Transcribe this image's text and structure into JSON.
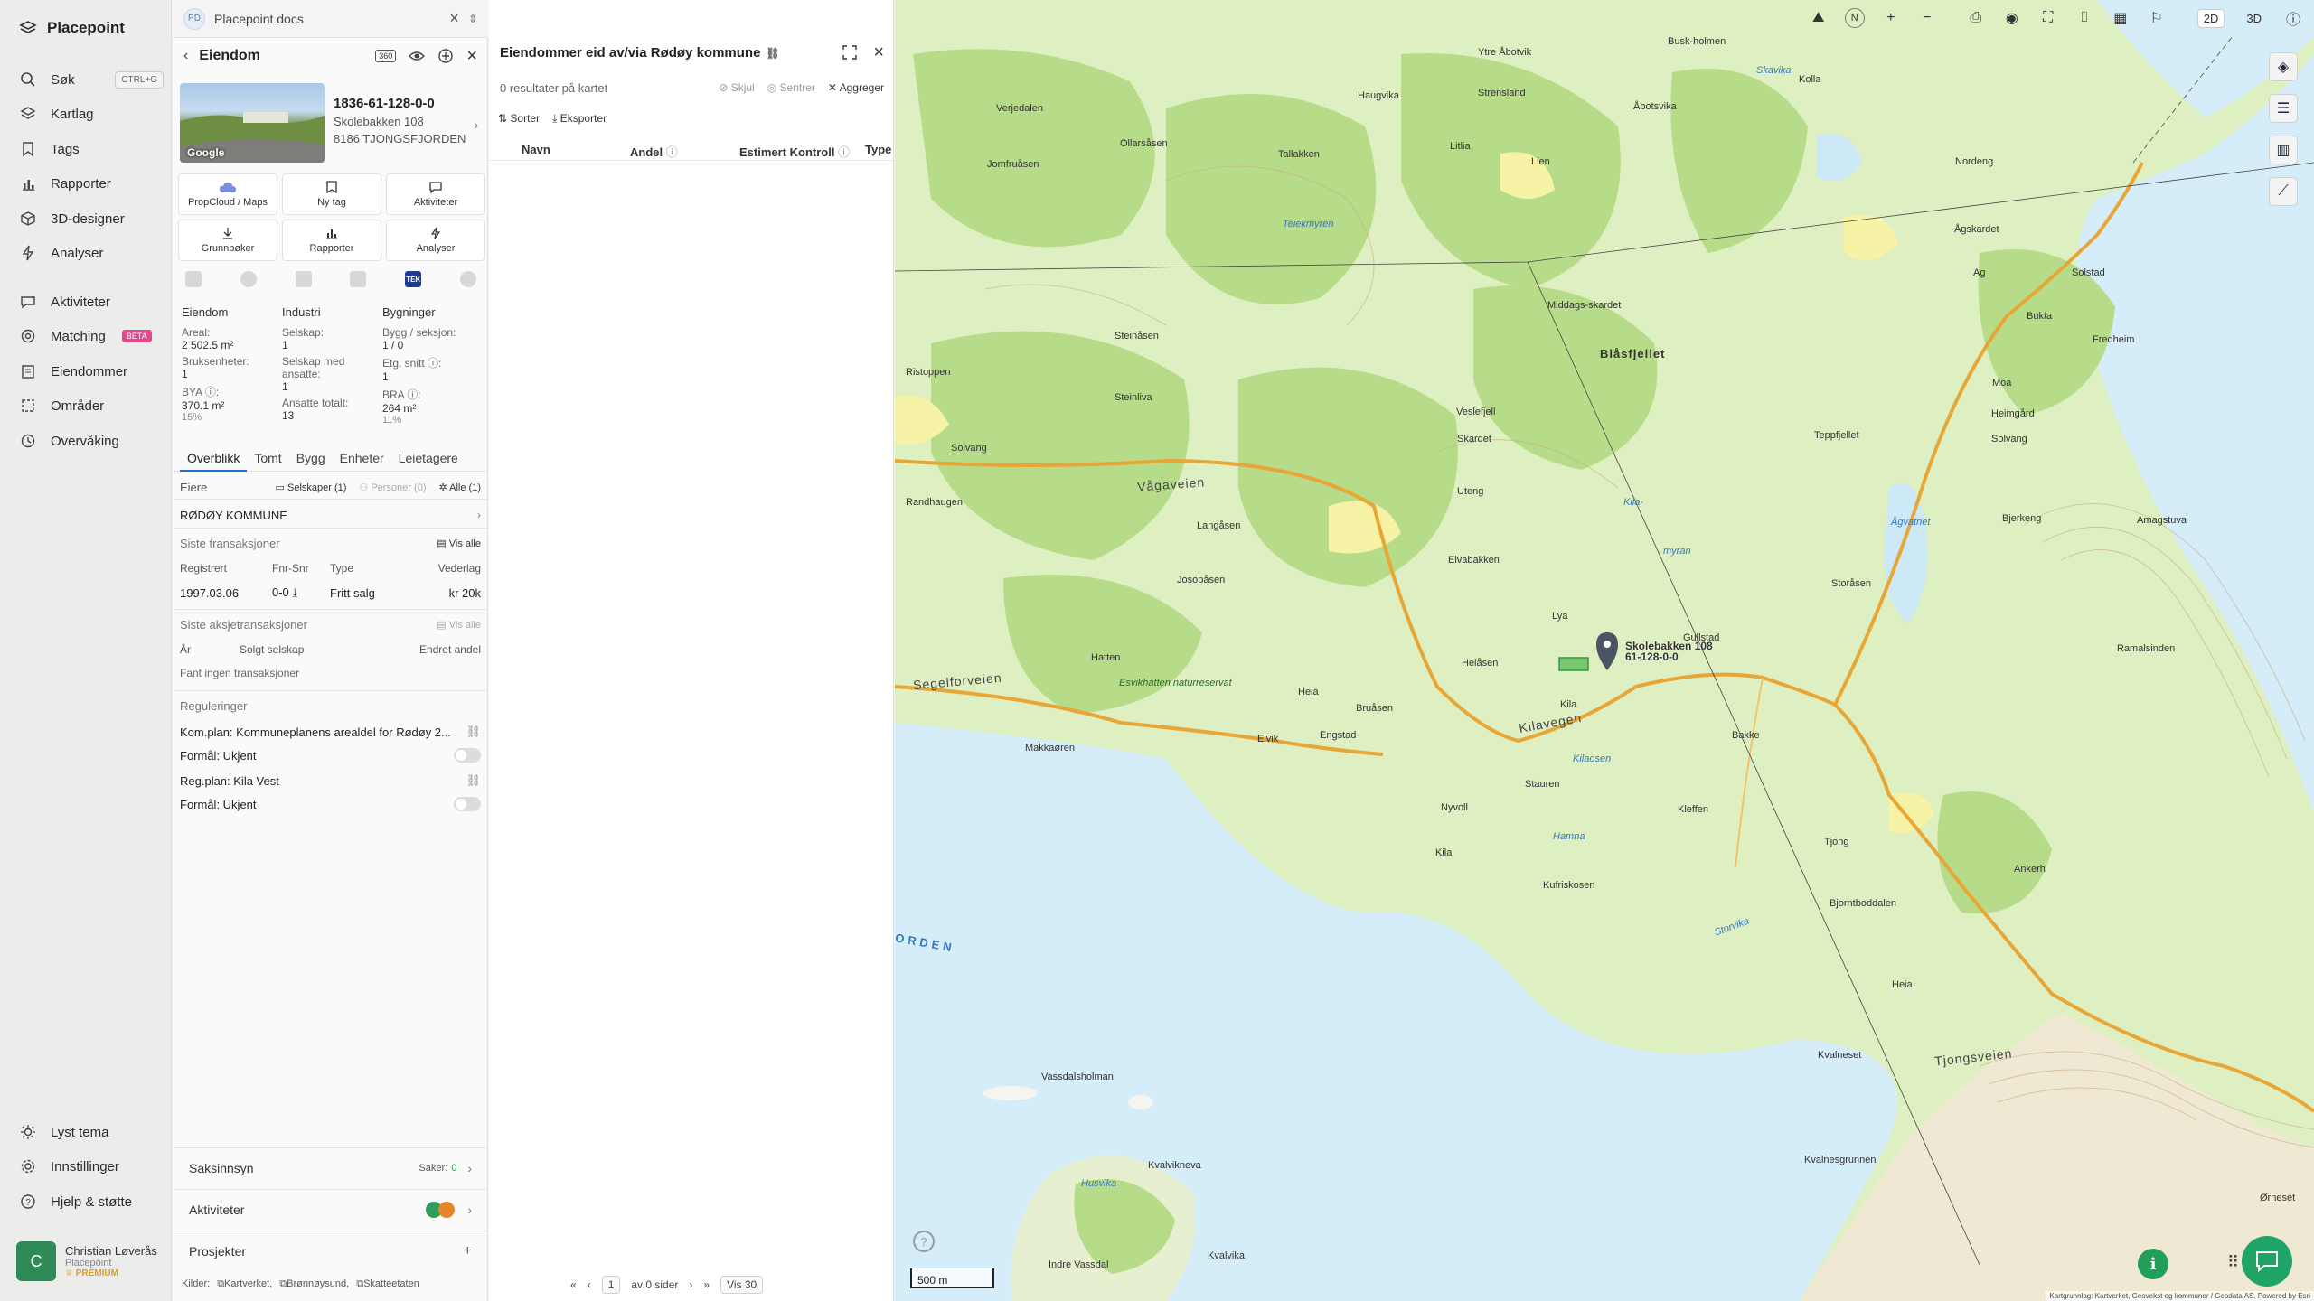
{
  "sidebar": {
    "brand": "Placepoint",
    "search_shortcut": "CTRL+G",
    "items": [
      {
        "label": "Søk"
      },
      {
        "label": "Kartlag"
      },
      {
        "label": "Tags"
      },
      {
        "label": "Rapporter"
      },
      {
        "label": "3D-designer"
      },
      {
        "label": "Analyser"
      },
      {
        "label": "Aktiviteter"
      },
      {
        "label": "Matching",
        "badge": "BETA"
      },
      {
        "label": "Eiendommer"
      },
      {
        "label": "Områder"
      },
      {
        "label": "Overvåking"
      }
    ],
    "bottom": [
      {
        "label": "Lyst tema"
      },
      {
        "label": "Innstillinger"
      },
      {
        "label": "Hjelp & støtte"
      }
    ],
    "user": {
      "initial": "C",
      "name": "Christian Løverås",
      "org": "Placepoint",
      "plan": "PREMIUM"
    }
  },
  "docs": {
    "logo": "PD",
    "title": "Placepoint docs"
  },
  "property": {
    "header": "Eiendom",
    "badge360": "360",
    "photo_credit": "Google",
    "id": "1836-61-128-0-0",
    "address1": "Skolebakken 108",
    "address2": "8186 TJONGSFJORDEN",
    "actions": [
      {
        "label": "PropCloud / Maps"
      },
      {
        "label": "Ny tag"
      },
      {
        "label": "Aktiviteter"
      },
      {
        "label": "Grunnbøker"
      },
      {
        "label": "Rapporter"
      },
      {
        "label": "Analyser"
      }
    ],
    "tek_label": "TEK",
    "stats": {
      "col1": {
        "heading": "Eiendom",
        "areal_label": "Areal:",
        "areal": "2 502.5 m²",
        "bruks_label": "Bruksenheter:",
        "bruks": "1",
        "bya_label": "BYA ⓘ:",
        "bya": "370.1 m²",
        "bya_pct": "15%"
      },
      "col2": {
        "heading": "Industri",
        "selskap_label": "Selskap:",
        "selskap": "1",
        "ansatte_label": "Selskap med ansatte:",
        "ansatte": "1",
        "totalt_label": "Ansatte totalt:",
        "totalt": "13"
      },
      "col3": {
        "heading": "Bygninger",
        "bygg_label": "Bygg / seksjon:",
        "bygg": "1 / 0",
        "etg_label": "Etg. snitt ⓘ:",
        "etg": "1",
        "bra_label": "BRA ⓘ:",
        "bra": "264 m²",
        "bra_pct": "11%"
      }
    },
    "tabs": [
      {
        "label": "Overblikk"
      },
      {
        "label": "Tomt"
      },
      {
        "label": "Bygg"
      },
      {
        "label": "Enheter"
      },
      {
        "label": "Leietagere"
      }
    ],
    "owners": {
      "label": "Eiere",
      "f1": "Selskaper (1)",
      "f2": "Personer (0)",
      "f3": "Alle (1)",
      "owner": "RØDØY KOMMUNE"
    },
    "transactions": {
      "title": "Siste transaksjoner",
      "view_all": "Vis alle",
      "cols": [
        "Registrert",
        "Fnr-Snr",
        "Type",
        "Vederlag"
      ],
      "row": {
        "date": "1997.03.06",
        "fnr": "0-0",
        "type": "Fritt salg",
        "amount": "kr 20k"
      }
    },
    "share_tx": {
      "title": "Siste aksjetransaksjoner",
      "view_all": "Vis alle",
      "cols": [
        "År",
        "Solgt selskap",
        "Endret andel"
      ],
      "empty": "Fant ingen transaksjoner"
    },
    "regulations": {
      "title": "Reguleringer",
      "items": [
        "Kom.plan: Kommuneplanens arealdel for Rødøy 2...",
        "Formål: Ukjent",
        "Reg.plan: Kila Vest",
        "Formål: Ukjent"
      ]
    },
    "saksinnsyn": {
      "label": "Saksinnsyn",
      "count_label": "Saker:",
      "count": "0"
    },
    "aktiviteter": {
      "label": "Aktiviteter"
    },
    "prosjekter": {
      "label": "Prosjekter",
      "add": "+"
    },
    "sources": {
      "label": "Kilder:",
      "items": [
        "Kartverket",
        "Brønnøysund",
        "Skatteetaten"
      ]
    }
  },
  "owned": {
    "title": "Eiendommer eid av/via Rødøy kommune",
    "sub": "0 resultater på kartet",
    "skjul": "Skjul",
    "sentrer": "Sentrer",
    "aggreger": "Aggreger",
    "sort": "Sorter",
    "export": "Eksporter",
    "cols": [
      "Navn",
      "Andel",
      "Estimert Kontroll",
      "Type"
    ],
    "pager": {
      "page": "1",
      "of": "av 0 sider",
      "per": "Vis 30"
    }
  },
  "map": {
    "mode2d": "2D",
    "mode3d": "3D",
    "north": "N",
    "scale": "500 m",
    "marker_label1": "Skolebakken 108",
    "marker_label2": "61-128-0-0",
    "attribution": "Kartgrunnlag: Kartverket, Geovekst og kommuner / Geodata AS. Powered by Esri",
    "labels": [
      "Ytre Åbotvik",
      "Busk-holmen",
      "Skavika",
      "Haugvika",
      "Strensland",
      "Åbotsvika",
      "Kolla",
      "Verjedalen",
      "Ollarsåsen",
      "Tallakken",
      "Litlia",
      "Lien",
      "Nordeng",
      "Jomfruåsen",
      "Teiekmyren",
      "Ågskardet",
      "Middags-skardet",
      "Blåsfjellet",
      "Ag",
      "Solstad",
      "Bukta",
      "Steinåsen",
      "Fredheim",
      "Ristoppen",
      "Steinliva",
      "Veslefjell",
      "Moa",
      "Heimgård",
      "Solvang",
      "Skardet",
      "Teppfjellet",
      "Solvang",
      "Vågaveien",
      "Randhaugen",
      "Uteng",
      "Langåsen",
      "Kila-",
      "myran",
      "Bjerkeng",
      "Ågvatnet",
      "Amagstuva",
      "Elvabakken",
      "Josopåsen",
      "Storåsen",
      "Heiåsen",
      "Lya",
      "Kilavegen",
      "Gullstad",
      "Hatten",
      "Esvikhatten naturreservat",
      "Heia",
      "Ramalsinden",
      "Segelforveien",
      "Bruåsen",
      "Engstad",
      "Kila",
      "Eivik",
      "Bakke",
      "Makkaøren",
      "Kilaosen",
      "Stauren",
      "Nyvoll",
      "Kleffen",
      "Kila",
      "Hamna",
      "Tjong",
      "Kufriskosen",
      "Ankerh",
      "Bjorntboddalen",
      "Storvika",
      "ORDEN",
      "Heia",
      "Vassdalsholman",
      "Kvalneset",
      "Tjongsveien",
      "Kvalnesgrunnen",
      "Husvika",
      "Kvalvikneva",
      "Kvalvika",
      "Ørneset",
      "Indre Vassdal"
    ]
  }
}
